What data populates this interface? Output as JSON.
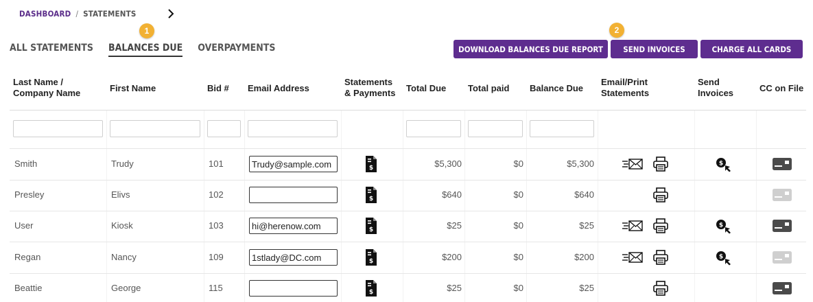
{
  "breadcrumb": {
    "home": "DASHBOARD",
    "separator": "/",
    "current": "STATEMENTS"
  },
  "tabs": [
    {
      "label": "ALL STATEMENTS"
    },
    {
      "label": "BALANCES DUE"
    },
    {
      "label": "OVERPAYMENTS"
    }
  ],
  "badges": {
    "one": "1",
    "two": "2"
  },
  "buttons": {
    "download": "DOWNLOAD BALANCES DUE REPORT",
    "send_invoices": "SEND INVOICES",
    "charge_all": "CHARGE ALL CARDS"
  },
  "columns": {
    "last_name": "Last Name / Company Name",
    "first_name": "First Name",
    "bid": "Bid #",
    "email": "Email Address",
    "statements": "Statements & Payments",
    "total_due": "Total Due",
    "total_paid": "Total paid",
    "balance_due": "Balance Due",
    "email_print": "Email/Print Statements",
    "send_invoices": "Send Invoices",
    "cc_on_file": "CC on File"
  },
  "rows": [
    {
      "last": "Smith",
      "first": "Trudy",
      "bid": "101",
      "email": "Trudy@sample.com",
      "total_due": "$5,300",
      "total_paid": "$0",
      "balance_due": "$5,300",
      "can_email": true,
      "can_invoice": true,
      "cc_active": true
    },
    {
      "last": "Presley",
      "first": "Elivs",
      "bid": "102",
      "email": "",
      "total_due": "$640",
      "total_paid": "$0",
      "balance_due": "$640",
      "can_email": false,
      "can_invoice": false,
      "cc_active": false
    },
    {
      "last": "User",
      "first": "Kiosk",
      "bid": "103",
      "email": "hi@herenow.com",
      "total_due": "$25",
      "total_paid": "$0",
      "balance_due": "$25",
      "can_email": true,
      "can_invoice": true,
      "cc_active": true
    },
    {
      "last": "Regan",
      "first": "Nancy",
      "bid": "109",
      "email": "1stlady@DC.com",
      "total_due": "$200",
      "total_paid": "$0",
      "balance_due": "$200",
      "can_email": true,
      "can_invoice": true,
      "cc_active": false
    },
    {
      "last": "Beattie",
      "first": "George",
      "bid": "115",
      "email": "",
      "total_due": "$25",
      "total_paid": "$0",
      "balance_due": "$25",
      "can_email": false,
      "can_invoice": false,
      "cc_active": true
    }
  ],
  "colors": {
    "accent": "#5e2d8f",
    "badge": "#f2b133",
    "cc_active": "#4a4a4a",
    "cc_inactive": "#cfcfcf"
  }
}
